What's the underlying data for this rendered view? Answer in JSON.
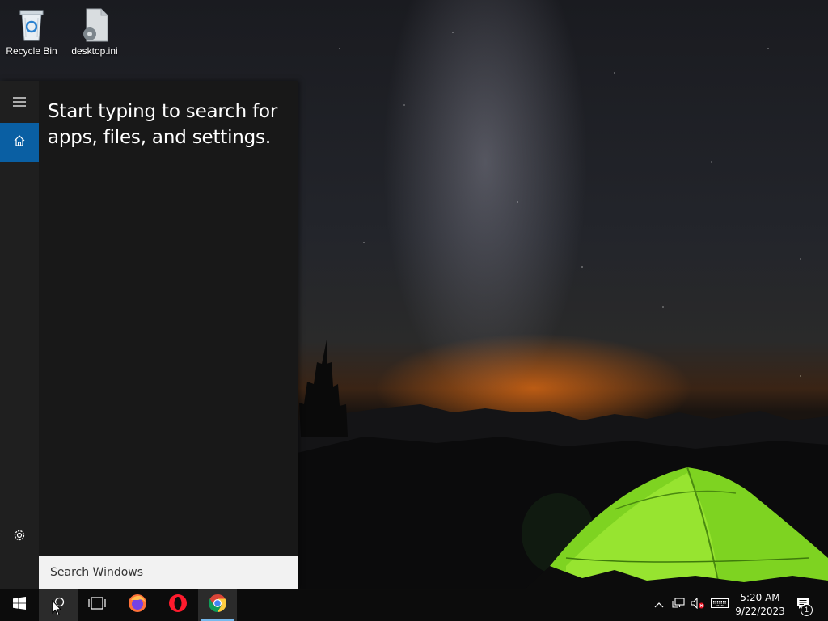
{
  "desktop": {
    "icons": [
      {
        "label": "Recycle Bin",
        "icon": "recycle-bin-icon"
      },
      {
        "label": "desktop.ini",
        "icon": "settings-file-icon"
      }
    ]
  },
  "search_panel": {
    "hint": "Start typing to search for apps, files, and settings.",
    "search_placeholder": "Search Windows",
    "rail": {
      "menu_icon": "hamburger-menu-icon",
      "home_icon": "home-icon",
      "settings_icon": "gear-icon"
    },
    "accent_color": "#0a5fa3"
  },
  "taskbar": {
    "start_icon": "windows-logo-icon",
    "search_icon": "search-icon",
    "taskview_icon": "task-view-icon",
    "pinned_apps": [
      {
        "name": "Firefox",
        "icon": "firefox-icon"
      },
      {
        "name": "Opera",
        "icon": "opera-icon"
      },
      {
        "name": "Chrome",
        "icon": "chrome-icon",
        "running": true
      }
    ],
    "tray": {
      "chevron_icon": "chevron-up-icon",
      "network_icon": "network-icon",
      "volume_icon": "volume-muted-icon",
      "keyboard_icon": "touch-keyboard-icon",
      "time": "5:20 AM",
      "date": "9/22/2023",
      "notification_icon": "action-center-icon",
      "notification_count": "1"
    }
  }
}
